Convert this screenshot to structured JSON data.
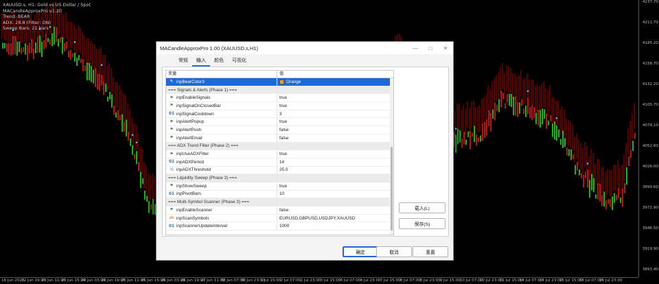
{
  "chart": {
    "info_lines": [
      "XAUUSD.s, H1:  Gold vs US Dollar / Spot",
      "MACandleApproxPro v1.20",
      "Trend: BEAR",
      "ADX: 28.8 (Filter: ON)",
      "Sweep Bars: 21 bars"
    ],
    "price_labels": [
      "4237.70",
      "4211.70",
      "4185.20",
      "4158.70",
      "4132.20",
      "4105.70",
      "4079.10",
      "4052.60",
      "4026.00",
      "3999.60",
      "3972.90",
      "3946.50",
      "3919.90",
      "3893.40"
    ],
    "time_labels": [
      "18 Jun 2025",
      "22 Jun 19:00",
      "23 Jun 11:00",
      "23 Jun 15:00",
      "24 Jun 03:00",
      "24 Jun 19:00",
      "25 Jun 11:00",
      "25 Jun 15:00",
      "26 Jun 03:00",
      "26 Jun 19:00",
      "27 Jun 11:00",
      "30 Jun 07:00",
      "30 Jun 23:00",
      "1 Jul 15:00",
      "2 Jul 07:00",
      "2 Jul 23:00",
      "3 Jul 15:00",
      "4 Jul 07:00",
      "4 Jul 23:00",
      "7 Jul 15:00",
      "8 Jul 07:00",
      "8 Jul 23:00",
      "9 Jul 15:00",
      "10 Jul 07:00",
      "10 Jul 23:00",
      "11 Jul 15:00",
      "14 Jul 07:00",
      "14 Jul 23:00",
      "15 Jul 15:00",
      "16 Jul 07:00",
      "16 Jul 23:00"
    ]
  },
  "dialog": {
    "title": "MACandleApproxPro 1.00 (XAUUSD.s,H1)",
    "controls": {
      "minimize": "—",
      "maximize": "□",
      "close": "✕"
    },
    "tabs": [
      "常规",
      "输入",
      "颜色",
      "可视化"
    ],
    "active_tab": "输入",
    "table": {
      "col_name": "变量",
      "col_value": "值",
      "rows": [
        {
          "kind": "param",
          "icon": "color-icon",
          "glyph": "✎",
          "name": "inpBearColor3",
          "value": "Orange",
          "selected": true,
          "swatch": "#f0a020"
        },
        {
          "kind": "section",
          "name": "=== Signals & Alerts (Phase 1) ==="
        },
        {
          "kind": "param",
          "icon": "bool-icon",
          "glyph": "⚑",
          "name": "inpEnableSignals",
          "value": "true"
        },
        {
          "kind": "param",
          "icon": "bool-icon",
          "glyph": "⚑",
          "name": "inpSignalOnClosedBar",
          "value": "true"
        },
        {
          "kind": "param",
          "icon": "int-icon",
          "glyph": "01",
          "name": "inpSignalCooldown",
          "value": "3"
        },
        {
          "kind": "param",
          "icon": "bool-icon",
          "glyph": "⚑",
          "name": "inpAlertPopup",
          "value": "true"
        },
        {
          "kind": "param",
          "icon": "bool-icon",
          "glyph": "⚑",
          "name": "inpAlertPush",
          "value": "false"
        },
        {
          "kind": "param",
          "icon": "bool-icon",
          "glyph": "⚑",
          "name": "inpAlertEmail",
          "value": "false"
        },
        {
          "kind": "section",
          "name": "=== ADX Trend Filter (Phase 2) ==="
        },
        {
          "kind": "param",
          "icon": "bool-icon",
          "glyph": "⚑",
          "name": "inpUseADXFilter",
          "value": "true"
        },
        {
          "kind": "param",
          "icon": "int-icon",
          "glyph": "01",
          "name": "inpADXPeriod",
          "value": "14"
        },
        {
          "kind": "param",
          "icon": "double-icon",
          "glyph": "½",
          "name": "inpADXThreshold",
          "value": "25.0"
        },
        {
          "kind": "section",
          "name": "=== Liquidity Sweep (Phase 3) ==="
        },
        {
          "kind": "param",
          "icon": "bool-icon",
          "glyph": "⚑",
          "name": "inpShowSweep",
          "value": "true"
        },
        {
          "kind": "param",
          "icon": "int-icon",
          "glyph": "01",
          "name": "inpPivotBars",
          "value": "10"
        },
        {
          "kind": "section",
          "name": "=== Multi-Symbol Scanner (Phase 3) ==="
        },
        {
          "kind": "param",
          "icon": "bool-icon",
          "glyph": "⚑",
          "name": "inpEnableScanner",
          "value": "false"
        },
        {
          "kind": "param",
          "icon": "string-icon",
          "glyph": "ab",
          "name": "inpScanSymbols",
          "value": "EURUSD,GBPUSD,USDJPY,XAUUSD"
        },
        {
          "kind": "param",
          "icon": "int-icon",
          "glyph": "01",
          "name": "inpScannerUpdateInterval",
          "value": "1000"
        }
      ]
    },
    "side_buttons": {
      "load": "载入(L)",
      "save": "保存(S)"
    },
    "bottom_buttons": {
      "ok": "确定",
      "cancel": "取消",
      "reset": "重置"
    }
  },
  "colors": {
    "bull_candle": "#19e619",
    "bear_candle": "#e61919",
    "band": "#cc0000",
    "accent": "#1f68d6",
    "dot": "#33ccff"
  }
}
